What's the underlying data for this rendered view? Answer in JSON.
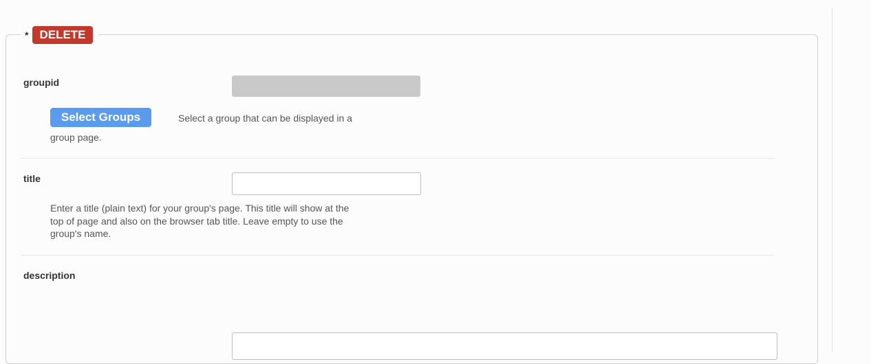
{
  "legend": {
    "asterisk": "*",
    "delete_label": "DELETE"
  },
  "fields": {
    "groupid": {
      "label": "groupid",
      "value": "",
      "select_button": "Select Groups",
      "help_line1": "Select a group that can be displayed in a",
      "help_line2": "group page."
    },
    "title": {
      "label": "title",
      "value": "",
      "help": [
        "Enter a title (plain text) for your group's page. This title will show at the",
        "top of page and also on the browser tab title. Leave empty to use the",
        "group's name."
      ]
    },
    "description": {
      "label": "description",
      "value": ""
    }
  },
  "colors": {
    "delete": "#c0392b",
    "select_button": "#5a9bf0",
    "readonly_bg": "#c9c9c9"
  }
}
